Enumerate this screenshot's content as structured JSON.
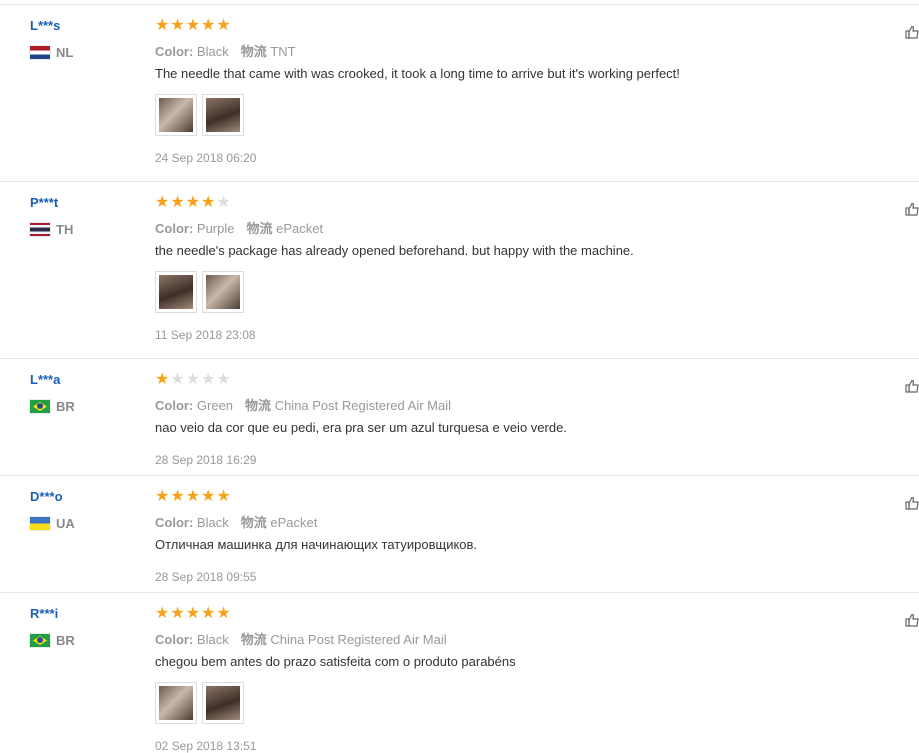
{
  "labels": {
    "color": "Color:",
    "logistics": "物流"
  },
  "colors": {
    "star_on": "#f7a21b",
    "star_off": "#dddddd",
    "name": "#1a5fb4"
  },
  "reviews": [
    {
      "user": "L***s",
      "country": "NL",
      "flag": "netherlands",
      "rating": 5,
      "color": "Black",
      "shipping": "TNT",
      "text": "The needle that came with was crooked, it took a long time to arrive but it's working perfect!",
      "photo_count": 2,
      "date": "24 Sep 2018 06:20"
    },
    {
      "user": "P***t",
      "country": "TH",
      "flag": "thailand",
      "rating": 4,
      "color": "Purple",
      "shipping": "ePacket",
      "text": "the needle's package has already opened beforehand. but happy with the machine.",
      "photo_count": 2,
      "date": "11 Sep 2018 23:08"
    },
    {
      "user": "L***a",
      "country": "BR",
      "flag": "brazil",
      "rating": 1,
      "color": "Green",
      "shipping": "China Post Registered Air Mail",
      "text": "nao veio da cor que eu pedi, era pra ser um azul turquesa e veio verde.",
      "photo_count": 0,
      "date": "28 Sep 2018 16:29"
    },
    {
      "user": "D***o",
      "country": "UA",
      "flag": "ukraine",
      "rating": 5,
      "color": "Black",
      "shipping": "ePacket",
      "text": "Отличная машинка для начинающих татуировщиков.",
      "photo_count": 0,
      "date": "28 Sep 2018 09:55"
    },
    {
      "user": "R***i",
      "country": "BR",
      "flag": "brazil",
      "rating": 5,
      "color": "Black",
      "shipping": "China Post Registered Air Mail",
      "text": "chegou bem antes do prazo satisfeita com o produto parabéns",
      "photo_count": 2,
      "date": "02 Sep 2018 13:51"
    }
  ]
}
